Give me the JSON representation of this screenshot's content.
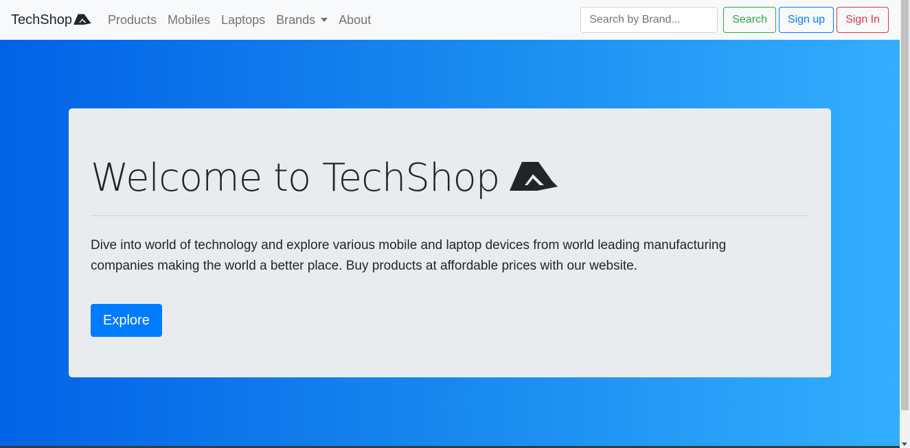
{
  "navbar": {
    "brand": "TechShop",
    "links": [
      {
        "label": "Products"
      },
      {
        "label": "Mobiles"
      },
      {
        "label": "Laptops"
      },
      {
        "label": "Brands"
      },
      {
        "label": "About"
      }
    ],
    "search_placeholder": "Search by Brand...",
    "search_value": "",
    "search_button": "Search",
    "signup_button": "Sign up",
    "signin_button": "Sign In"
  },
  "hero": {
    "title": "Welcome to TechShop",
    "lead": "Dive into world of technology and explore various mobile and laptop devices from world leading manufacturing companies making the world a better place. Buy products at affordable prices with our website.",
    "cta": "Explore"
  },
  "colors": {
    "navbar_bg": "#f8f9fa",
    "gradient_start": "#0262e6",
    "gradient_end": "#33aeff",
    "jumbotron_bg": "#e9ecef",
    "primary": "#007bff",
    "success": "#28a745",
    "danger": "#dc3545"
  },
  "icons": {
    "brand_logo": "techshop-logo-icon",
    "dropdown": "caret-down-icon"
  }
}
